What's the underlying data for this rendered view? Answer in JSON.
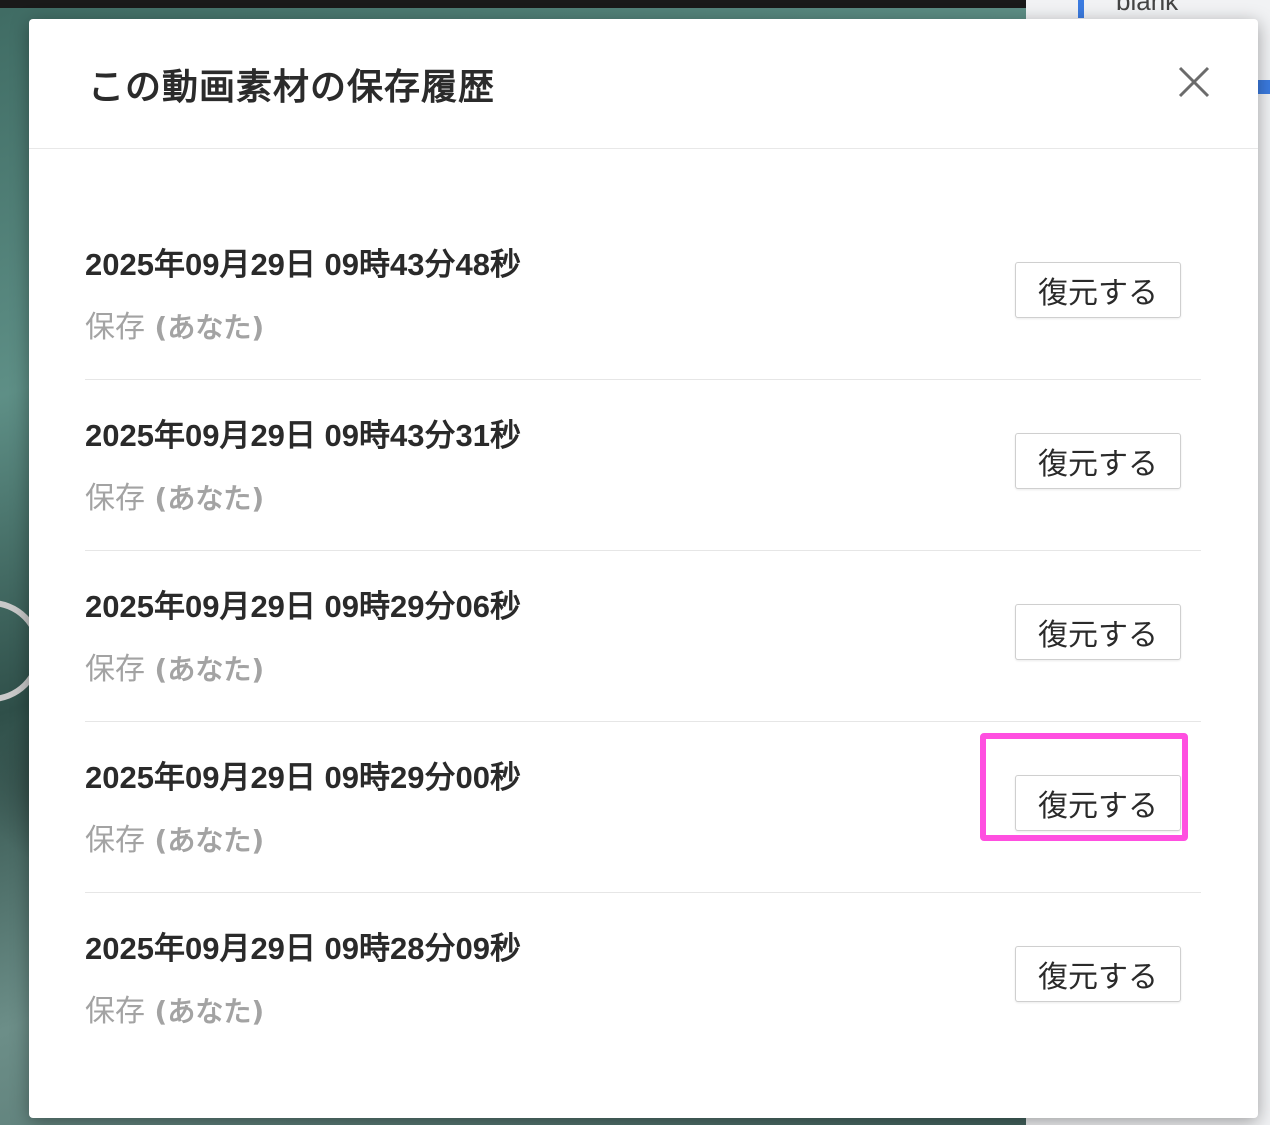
{
  "background": {
    "partial_text": "blank"
  },
  "dialog": {
    "title": "この動画素材の保存履歴",
    "close_icon": "close-icon"
  },
  "history": [
    {
      "timestamp": "2025年09月29日 09時43分48秒",
      "action": "保存",
      "user": "(あなた)",
      "restore_label": "復元する"
    },
    {
      "timestamp": "2025年09月29日 09時43分31秒",
      "action": "保存",
      "user": "(あなた)",
      "restore_label": "復元する"
    },
    {
      "timestamp": "2025年09月29日 09時29分06秒",
      "action": "保存",
      "user": "(あなた)",
      "restore_label": "復元する"
    },
    {
      "timestamp": "2025年09月29日 09時29分00秒",
      "action": "保存",
      "user": "(あなた)",
      "restore_label": "復元する"
    },
    {
      "timestamp": "2025年09月29日 09時28分09秒",
      "action": "保存",
      "user": "(あなた)",
      "restore_label": "復元する"
    }
  ],
  "colors": {
    "highlight": "#ff4fe0",
    "title_text": "#2b2b2b",
    "meta_text": "#a3a3a3"
  }
}
